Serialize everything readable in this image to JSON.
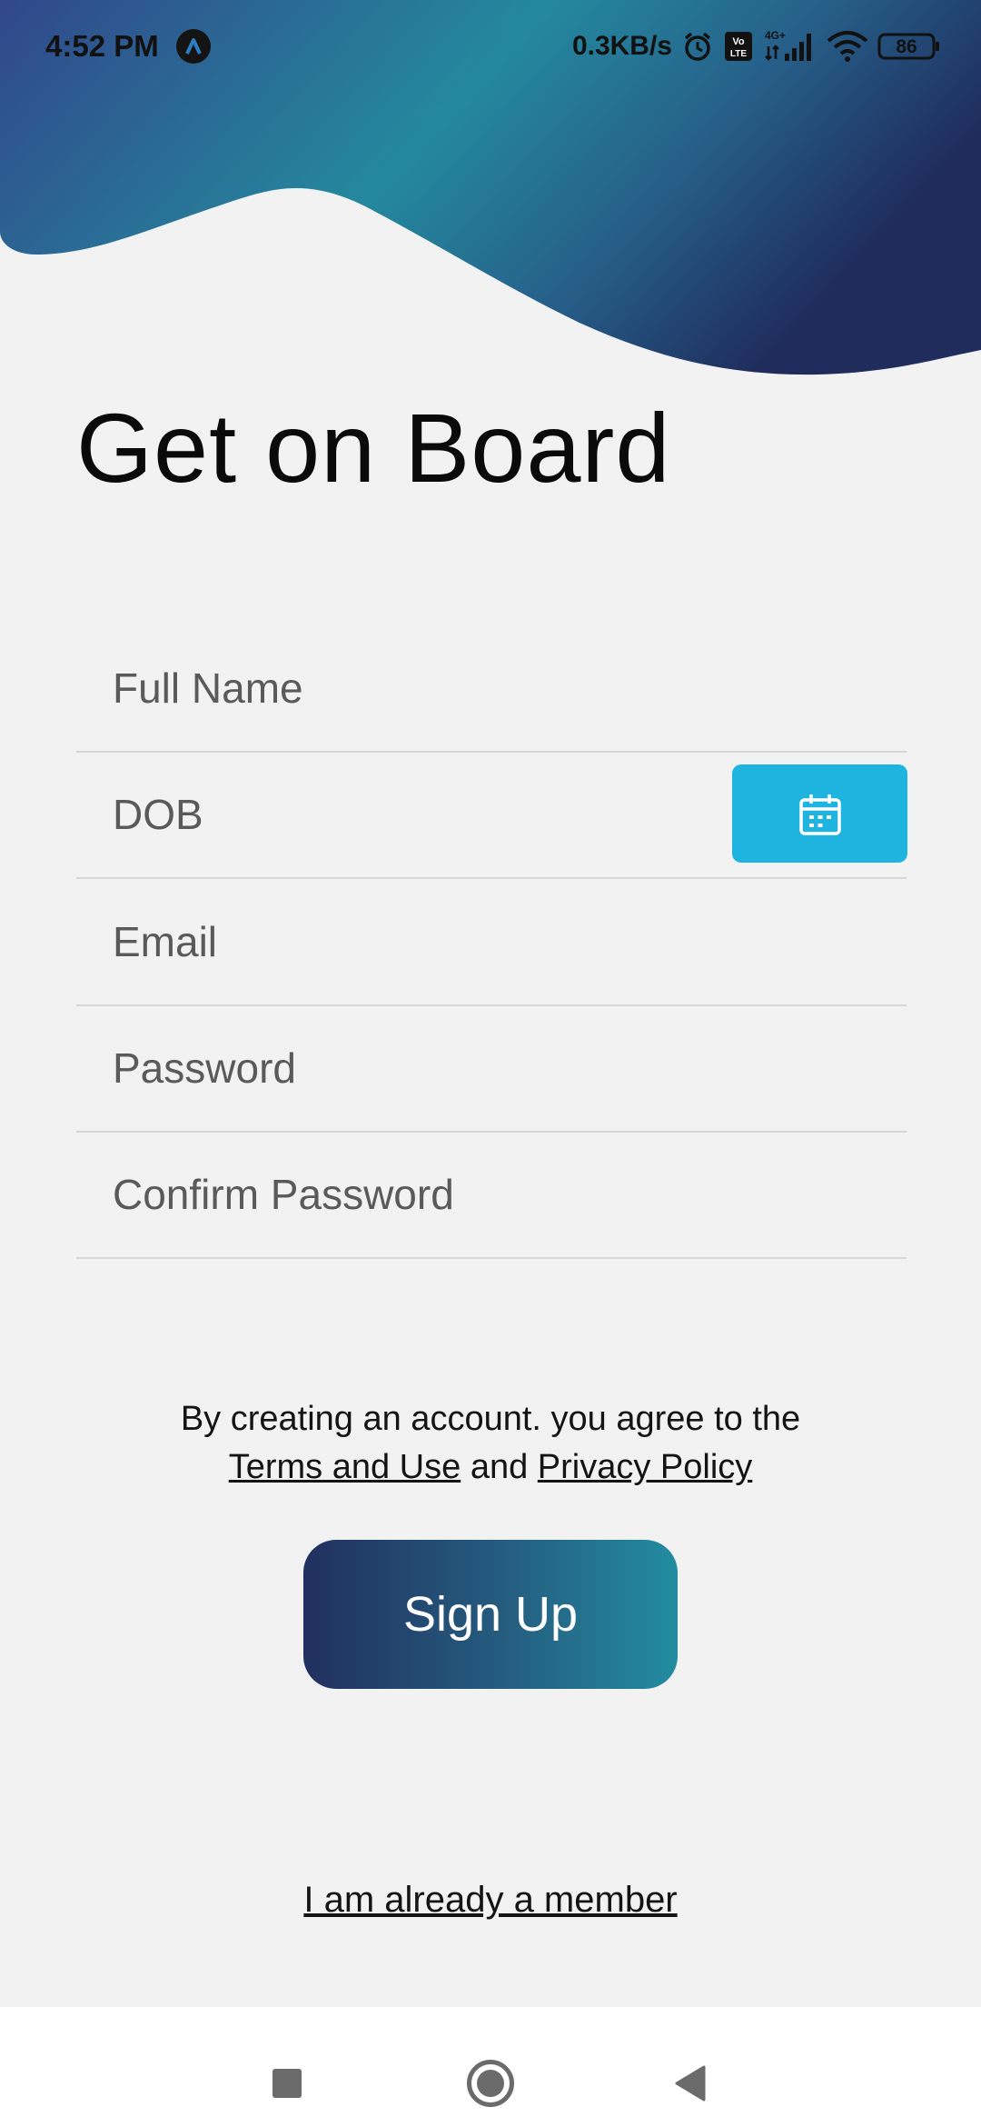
{
  "colors": {
    "background": "#f2f2f3",
    "wave_dark": "#253a6f",
    "wave_teal": "#24899e",
    "calendar_button": "#1fb4df",
    "signup_gradient": [
      "#21305f",
      "#228ca0"
    ],
    "divider": "#d6d6d8"
  },
  "status_bar": {
    "time": "4:52 PM",
    "net_speed": "0.3KB/s",
    "battery": "86",
    "icons": [
      "app-notification-icon",
      "alarm-icon",
      "volte-icon",
      "signal-4g-icon",
      "wifi-icon",
      "battery-icon"
    ]
  },
  "title": "Get on Board",
  "form": {
    "full_name": "Full Name",
    "dob": "DOB",
    "email": "Email",
    "password": "Password",
    "confirm_password": "Confirm Password",
    "calendar_icon": "calendar-icon"
  },
  "terms": {
    "line1": "By creating an account. you agree to the",
    "terms_link": "Terms and Use",
    "and": "and",
    "privacy_link": "Privacy Policy"
  },
  "signup_button": "Sign Up",
  "member_link": "I am already a member",
  "nav": {
    "icons": [
      "recents-icon",
      "home-icon",
      "back-icon"
    ]
  }
}
